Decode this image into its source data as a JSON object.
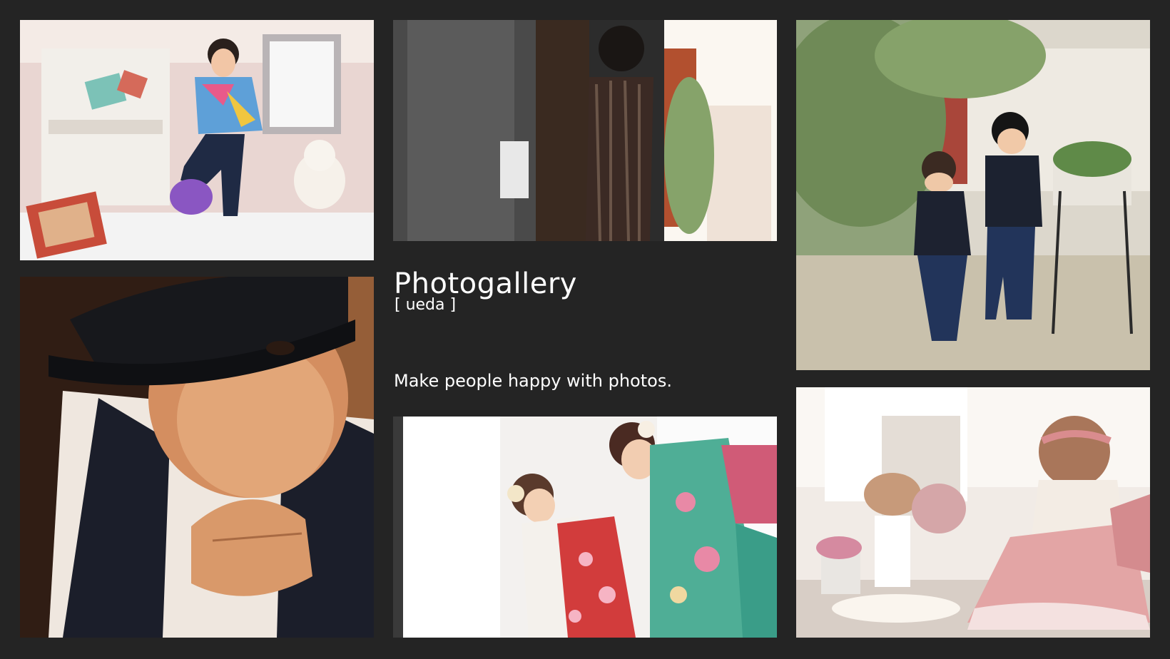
{
  "gallery": {
    "title": "Photogallery",
    "subtitle": "[ ueda ]",
    "tagline": "Make people happy with photos."
  },
  "photos": [
    {
      "id": "girl-kicking",
      "subject": "girl in colorful sweater kicking toy blocks"
    },
    {
      "id": "boy-doorway",
      "subject": "silhouette of boy standing in doorway"
    },
    {
      "id": "kids-garden",
      "subject": "two toddlers playing in garden"
    },
    {
      "id": "boy-hat",
      "subject": "portrait of boy in black hat"
    },
    {
      "id": "kimono",
      "subject": "mother and child in kimono"
    },
    {
      "id": "baby-dress",
      "subject": "baby in pink dress sitting"
    }
  ],
  "colors": {
    "background": "#242424",
    "text": "#ffffff"
  }
}
